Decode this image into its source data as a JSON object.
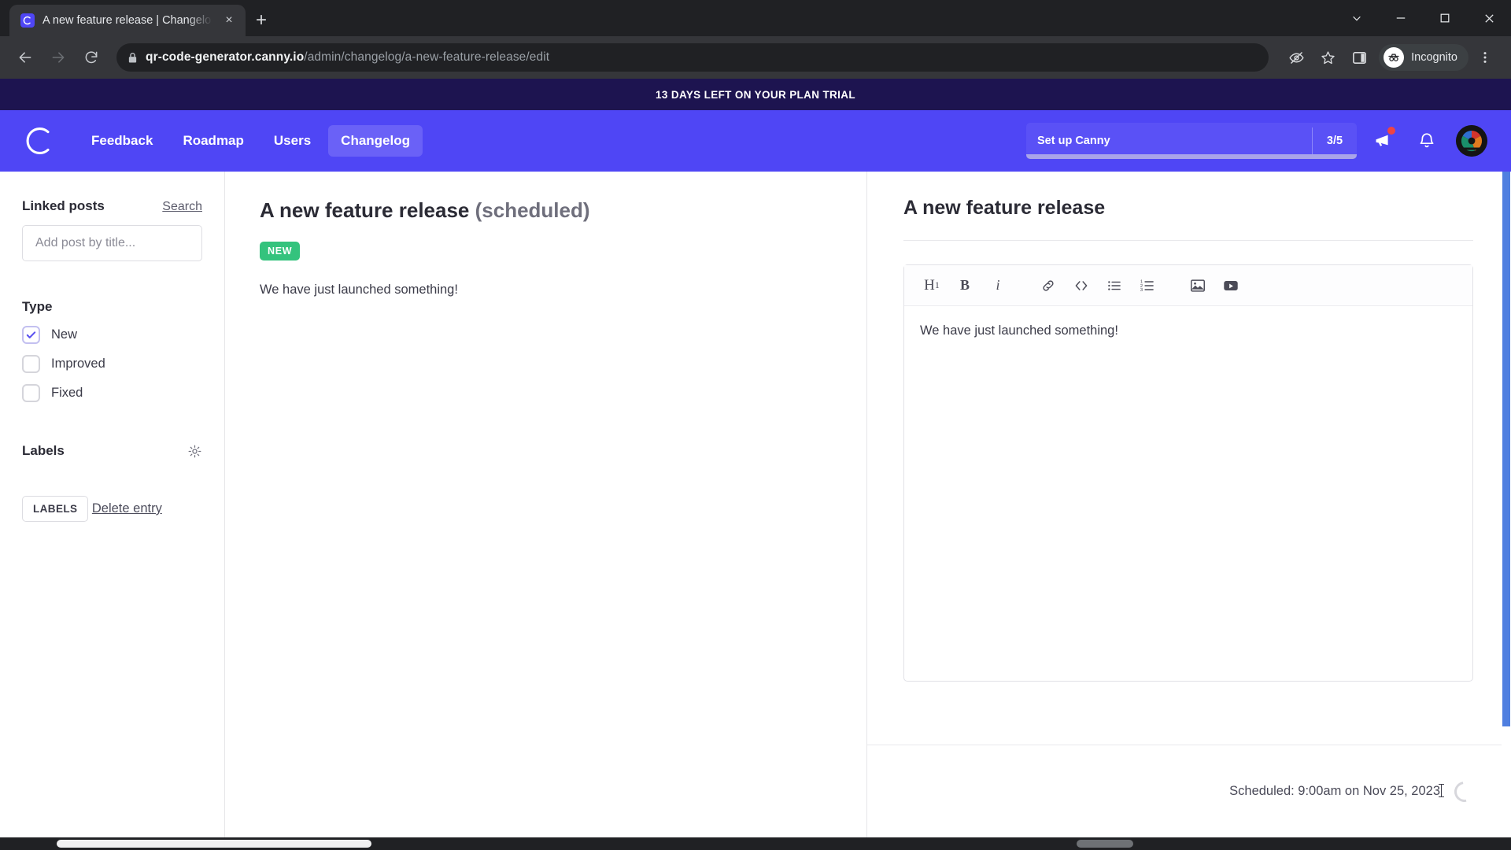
{
  "browser": {
    "tab": {
      "title": "A new feature release | Changelo",
      "favicon": "canny-logo-icon",
      "close": "×"
    },
    "new_tab_label": "+",
    "url_bold": "qr-code-generator.canny.io",
    "url_rest": "/admin/changelog/a-new-feature-release/edit",
    "incognito_label": "Incognito"
  },
  "banner": {
    "text": "13 DAYS LEFT ON YOUR PLAN TRIAL"
  },
  "appbar": {
    "nav": [
      {
        "label": "Feedback",
        "active": false
      },
      {
        "label": "Roadmap",
        "active": false
      },
      {
        "label": "Users",
        "active": false
      },
      {
        "label": "Changelog",
        "active": true
      }
    ],
    "setup": {
      "label": "Set up Canny",
      "count": "3/5",
      "progress": 60
    }
  },
  "sidebar": {
    "linked_posts_title": "Linked posts",
    "search_label": "Search",
    "add_post_placeholder": "Add post by title...",
    "type_title": "Type",
    "types": [
      {
        "label": "New",
        "checked": true
      },
      {
        "label": "Improved",
        "checked": false
      },
      {
        "label": "Fixed",
        "checked": false
      }
    ],
    "labels_title": "Labels",
    "labels_chip": "LABELS",
    "delete_label": "Delete entry"
  },
  "center": {
    "title": "A new feature release",
    "status": "(scheduled)",
    "tag": "NEW",
    "body": "We have just launched something!"
  },
  "editor_panel": {
    "title": "A new feature release",
    "toolbar": [
      {
        "name": "heading-1",
        "glyph": "H1"
      },
      {
        "name": "bold",
        "glyph": "B"
      },
      {
        "name": "italic",
        "glyph": "i"
      },
      {
        "name": "link",
        "glyph": "link"
      },
      {
        "name": "code",
        "glyph": "<>"
      },
      {
        "name": "bulleted-list",
        "glyph": "ul"
      },
      {
        "name": "numbered-list",
        "glyph": "ol"
      },
      {
        "name": "image",
        "glyph": "image"
      },
      {
        "name": "video",
        "glyph": "video"
      }
    ],
    "content": "We have just launched something!",
    "scheduled_text": "Scheduled: 9:00am on Nov 25, 2023"
  },
  "colors": {
    "brand": "#4f46f5",
    "banner": "#1d1450",
    "tag_new": "#34c37d",
    "scrollbar": "#4f7fe0"
  }
}
